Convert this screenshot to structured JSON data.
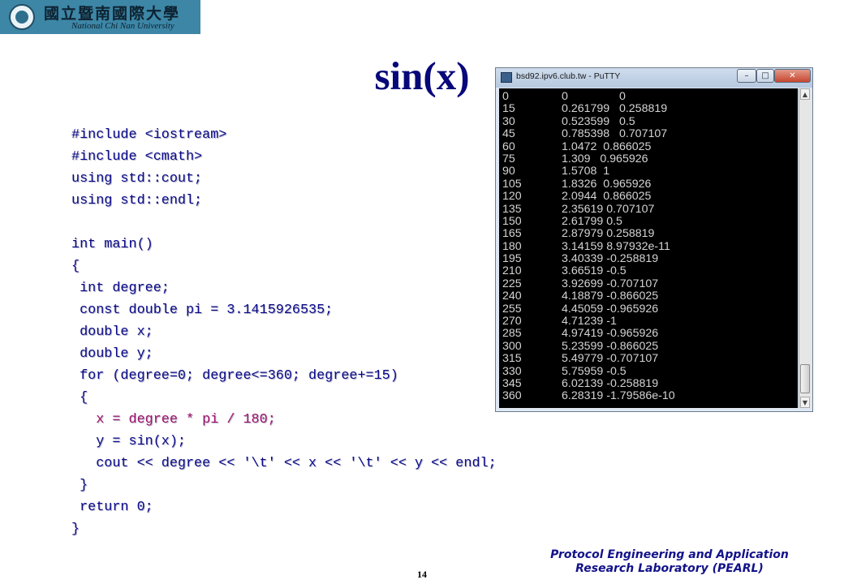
{
  "logo": {
    "chinese_name": "國立暨南國際大學",
    "english_name": "National Chi Nan University"
  },
  "slide": {
    "title": "sin(x)",
    "page_number": "14",
    "footer_line1": "Protocol Engineering and Application",
    "footer_line2": "Research Laboratory (PEARL)"
  },
  "code_lines": [
    {
      "text": "#include <iostream>",
      "highlight": false
    },
    {
      "text": "#include <cmath>",
      "highlight": false
    },
    {
      "text": "using std::cout;",
      "highlight": false
    },
    {
      "text": "using std::endl;",
      "highlight": false
    },
    {
      "text": "",
      "highlight": false
    },
    {
      "text": "int main()",
      "highlight": false
    },
    {
      "text": "{",
      "highlight": false
    },
    {
      "text": " int degree;",
      "highlight": false
    },
    {
      "text": " const double pi = 3.1415926535;",
      "highlight": false
    },
    {
      "text": " double x;",
      "highlight": false
    },
    {
      "text": " double y;",
      "highlight": false
    },
    {
      "text": " for (degree=0; degree<=360; degree+=15)",
      "highlight": false
    },
    {
      "text": " {",
      "highlight": false
    },
    {
      "text": "   x = degree * pi / 180;",
      "highlight": true
    },
    {
      "text": "   y = sin(x);",
      "highlight": false
    },
    {
      "text": "   cout << degree << '\\t' << x << '\\t' << y << endl;",
      "highlight": false
    },
    {
      "text": " }",
      "highlight": false
    },
    {
      "text": " return 0;",
      "highlight": false
    },
    {
      "text": "}",
      "highlight": false
    }
  ],
  "putty": {
    "window_title": "bsd92.ipv6.club.tw - PuTTY",
    "buttons": {
      "minimize": "–",
      "maximize": "□",
      "close": "✕"
    },
    "icons": {
      "app": "putty-icon",
      "scroll_up": "▲",
      "scroll_down": "▼"
    },
    "colors": {
      "background": "#000000",
      "text": "#d4d4d4"
    },
    "rows": [
      [
        "0",
        "0\t0"
      ],
      [
        "15",
        "0.261799\t0.258819"
      ],
      [
        "30",
        "0.523599\t0.5"
      ],
      [
        "45",
        "0.785398\t0.707107"
      ],
      [
        "60",
        "1.0472  0.866025"
      ],
      [
        "75",
        "1.309   0.965926"
      ],
      [
        "90",
        "1.5708  1"
      ],
      [
        "105",
        "1.8326  0.965926"
      ],
      [
        "120",
        "2.0944  0.866025"
      ],
      [
        "135",
        "2.35619 0.707107"
      ],
      [
        "150",
        "2.61799 0.5"
      ],
      [
        "165",
        "2.87979 0.258819"
      ],
      [
        "180",
        "3.14159 8.97932e-11"
      ],
      [
        "195",
        "3.40339 -0.258819"
      ],
      [
        "210",
        "3.66519 -0.5"
      ],
      [
        "225",
        "3.92699 -0.707107"
      ],
      [
        "240",
        "4.18879 -0.866025"
      ],
      [
        "255",
        "4.45059 -0.965926"
      ],
      [
        "270",
        "4.71239 -1"
      ],
      [
        "285",
        "4.97419 -0.965926"
      ],
      [
        "300",
        "5.23599 -0.866025"
      ],
      [
        "315",
        "5.49779 -0.707107"
      ],
      [
        "330",
        "5.75959 -0.5"
      ],
      [
        "345",
        "6.02139 -0.258819"
      ],
      [
        "360",
        "6.28319 -1.79586e-10"
      ]
    ]
  }
}
